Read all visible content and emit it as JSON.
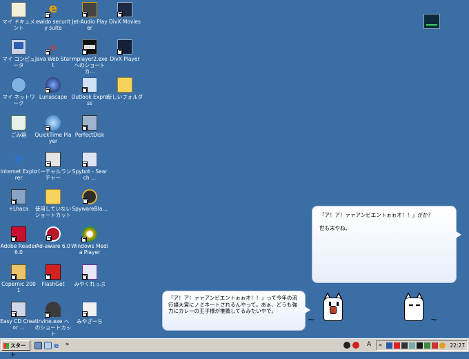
{
  "desktop": {
    "icons": [
      {
        "label": "マイ ドキュメント"
      },
      {
        "label": "ewido security suite"
      },
      {
        "label": "Jet-Audio Player"
      },
      {
        "label": "DivX Movies"
      },
      {
        "label": "マイ コンピュータ"
      },
      {
        "label": "Java Web Start"
      },
      {
        "label": "mplayer2.exe へのショートカ..."
      },
      {
        "label": "DivX Player"
      },
      {
        "label": "マイ ネットワーク"
      },
      {
        "label": "Lunascape"
      },
      {
        "label": "Outlook Express"
      },
      {
        "label": "新しいフォルダ"
      },
      {
        "label": "ごみ箱"
      },
      {
        "label": "QuickTime Player"
      },
      {
        "label": "PerfectDisk"
      },
      {
        "label": "Internet Explorer"
      },
      {
        "label": "バーチャルランチャー"
      },
      {
        "label": "Spybot - Search ..."
      },
      {
        "label": "+Lhaca"
      },
      {
        "label": "使用していないショートカット"
      },
      {
        "label": "SpywareBla..."
      },
      {
        "label": "Adobe Reader 6.0"
      },
      {
        "label": "Ad-aware 6.0"
      },
      {
        "label": "Windows Media Player"
      },
      {
        "label": "Copernic 2001"
      },
      {
        "label": "FlashGet"
      },
      {
        "label": "みやくれっぷ"
      },
      {
        "label": "Easy CD Creator ..."
      },
      {
        "label": "irvine.exe へのショートカット"
      },
      {
        "label": "みやざーち"
      }
    ]
  },
  "bubbles": {
    "right_line1": "「ア！ア！ァァアンビエントぉぉオ！！」がか？",
    "right_line2": "世も末やね。",
    "left_text": "「ア！ア！ァァアンビエントぉぉオ！！」って今年の流行語大賞にノミネートされるんやって。あぁ、どうも強力にカレーの王子様が推薦してるみたいやで。"
  },
  "taskbar": {
    "start_label": "スタート",
    "chevron": "»",
    "tray_chevron": "«",
    "ime_label": "A",
    "clock": "22:27"
  },
  "colors": {
    "desktop": "#3a6ea5",
    "taskbar": "#d4d0c8"
  }
}
